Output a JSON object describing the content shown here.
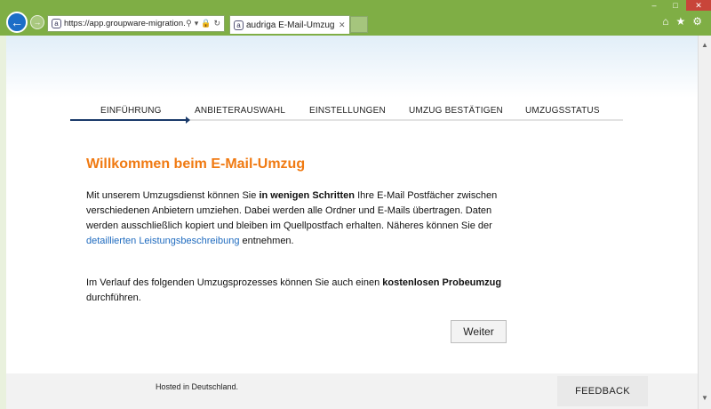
{
  "browser": {
    "url": "https://app.groupware-migration.com",
    "tab_title": "audriga E-Mail-Umzug",
    "site_icon_glyph": "a",
    "window_controls": [
      "–",
      "□",
      "✕"
    ],
    "tools": [
      "⌂",
      "★",
      "⚙"
    ]
  },
  "steps": [
    "EINFÜHRUNG",
    "ANBIETERAUSWAHL",
    "EINSTELLUNGEN",
    "UMZUG BESTÄTIGEN",
    "UMZUGSSTATUS"
  ],
  "active_step": "EINFÜHRUNG",
  "main": {
    "title": "Willkommen beim E-Mail-Umzug",
    "p1_a": "Mit unserem Umzugsdienst können Sie ",
    "p1_bold": "in wenigen Schritten",
    "p1_b": " Ihre E-Mail Postfächer zwischen verschiedenen Anbietern umziehen. Dabei werden alle Ordner und E-Mails übertragen. Daten werden ausschließlich kopiert und bleiben im Quellpostfach erhalten. Näheres können Sie der ",
    "p1_link": "detaillierten Leistungsbeschreibung",
    "p1_c": " entnehmen.",
    "p2_a": "Im Verlauf des folgenden Umzugsprozesses können Sie auch einen ",
    "p2_bold": "kostenlosen Probeumzug",
    "p2_b": " durchführen.",
    "button_label": "Weiter"
  },
  "footer": {
    "hosted": "Hosted in Deutschland.",
    "feedback": "FEEDBACK"
  },
  "colors": {
    "chrome": "#7fae45",
    "accent_title": "#f07a12",
    "link": "#1f6bbf",
    "active_step": "#1a3a6a"
  }
}
